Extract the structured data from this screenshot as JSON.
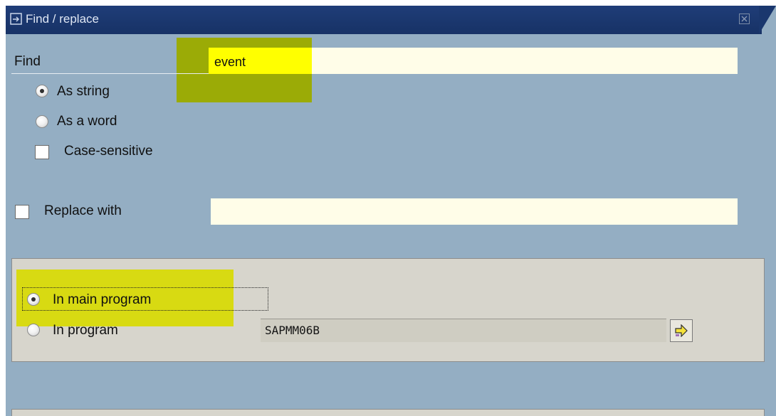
{
  "window": {
    "title": "Find / replace",
    "title_icon": "window-menu-icon",
    "close_icon": "close-icon"
  },
  "find": {
    "label": "Find",
    "value": "event",
    "options": [
      {
        "label": "As string",
        "type": "radio",
        "selected": true
      },
      {
        "label": "As a word",
        "type": "radio",
        "selected": false
      },
      {
        "label": "Case-sensitive",
        "type": "checkbox",
        "checked": false
      }
    ]
  },
  "replace": {
    "label": "Replace with",
    "checked": false,
    "value": ""
  },
  "scope": {
    "main_program_label": "In main program",
    "main_program_selected": true,
    "program_label": "In program",
    "program_selected": false,
    "program_value": "SAPMM06B",
    "execute_icon": "arrow-right-icon"
  },
  "colors": {
    "title_bar": "#1f3d78",
    "background": "#94aec3",
    "group_box": "#d7d5cc",
    "highlight_green": "#9bab06",
    "highlight_yellow": "#ffff00"
  }
}
